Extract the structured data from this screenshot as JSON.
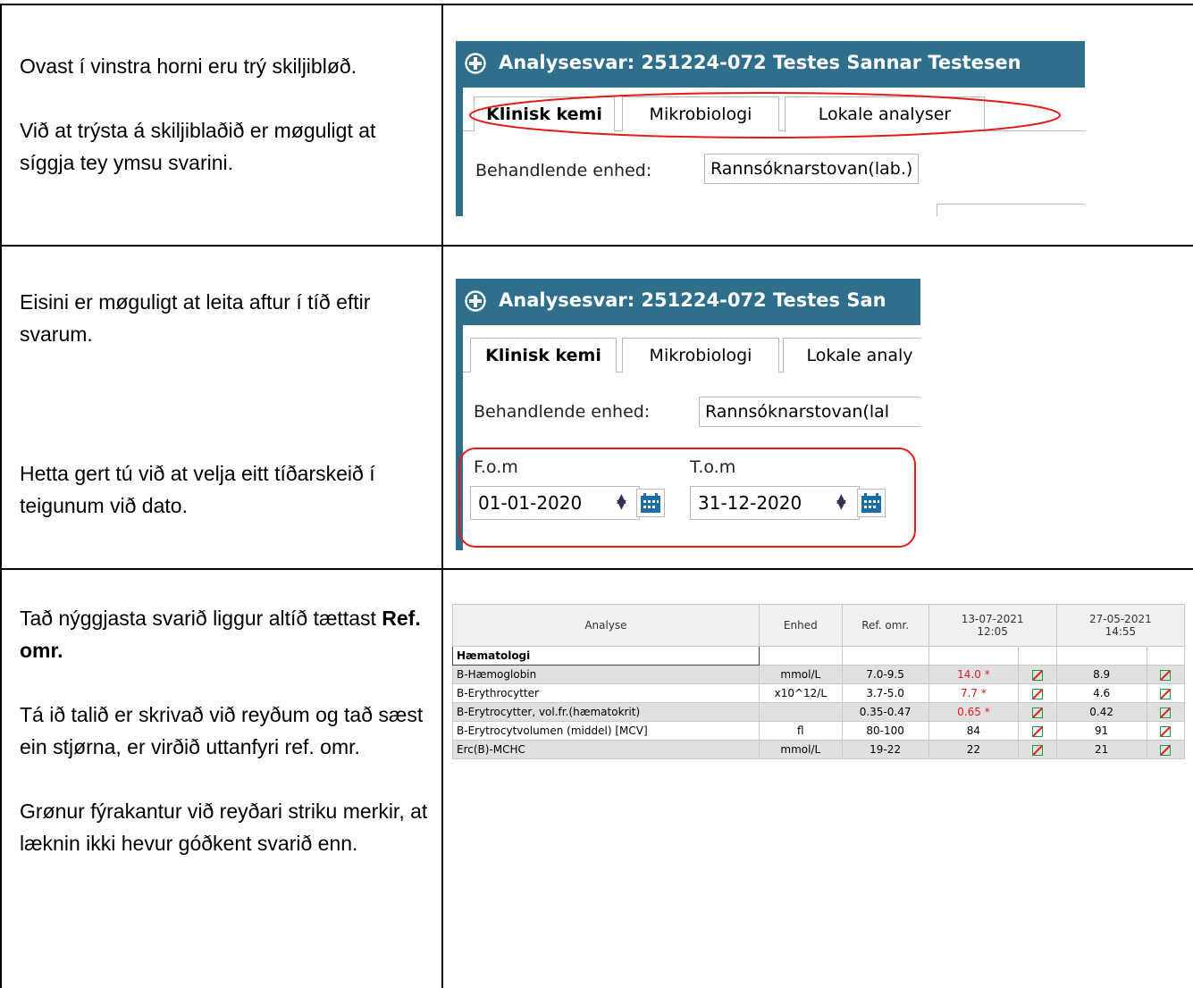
{
  "row1": {
    "paragraphs": [
      "Ovast í vinstra horni eru trý skiljibløð.",
      "Við at trýsta á skiljiblaðið er møguligt at síggja tey ymsu svarini."
    ]
  },
  "row2": {
    "paragraphs": [
      "Eisini er møguligt at leita aftur í tíð eftir svarum.",
      "Hetta gert tú við at velja eitt tíðarskeið í teigunum við dato."
    ]
  },
  "row3": {
    "p1_text": "Tað nýggjasta svarið liggur altíð tættast ",
    "p1_bold": "Ref. omr.",
    "paragraphs": [
      "Tá ið talið er skrivað við reyðum og tað sæst ein stjørna, er virðið uttanfyri ref. omr.",
      "Grønur fýrakantur við reyðari striku merkir, at læknin ikki hevur góðkent svarið enn."
    ]
  },
  "shot1": {
    "title": "Analysesvar: 251224-072 Testes Sannar Testesen",
    "tabs": [
      "Klinisk kemi",
      "Mikrobiologi",
      "Lokale analyser"
    ],
    "unit_label": "Behandlende enhed:",
    "unit_value": "Rannsóknarstovan(lab.)"
  },
  "shot2": {
    "title": "Analysesvar: 251224-072 Testes San",
    "tabs": [
      "Klinisk kemi",
      "Mikrobiologi",
      "Lokale analy"
    ],
    "unit_label": "Behandlende enhed:",
    "unit_value": "Rannsóknarstovan(lal",
    "from_label": "F.o.m",
    "from_value": "01-01-2020",
    "to_label": "T.o.m",
    "to_value": "31-12-2020"
  },
  "results": {
    "headers": [
      "Analyse",
      "Enhed",
      "Ref. omr."
    ],
    "dates": [
      {
        "date": "13-07-2021",
        "time": "12:05"
      },
      {
        "date": "27-05-2021",
        "time": "14:55"
      }
    ],
    "group": "Hæmatologi",
    "rows": [
      {
        "name": "B-Hæmoglobin",
        "unit": "mmol/L",
        "ref": "7.0-9.5",
        "v1": "14.0 *",
        "v2": "8.9"
      },
      {
        "name": "B-Erythrocytter",
        "unit": "x10^12/L",
        "ref": "3.7-5.0",
        "v1": "7.7 *",
        "v2": "4.6"
      },
      {
        "name": "B-Erytrocytter, vol.fr.(hæmatokrit)",
        "unit": "",
        "ref": "0.35-0.47",
        "v1": "0.65 *",
        "v2": "0.42"
      },
      {
        "name": "B-Erytrocytvolumen (middel) [MCV]",
        "unit": "fl",
        "ref": "80-100",
        "v1": "84",
        "v2": "91"
      },
      {
        "name": "Erc(B)-MCHC",
        "unit": "mmol/L",
        "ref": "19-22",
        "v1": "22",
        "v2": "21"
      }
    ]
  },
  "colors": {
    "titlebar": "#2f6f8c",
    "highlight": "#e41b1b",
    "approval_box": "#1f9a3a"
  }
}
